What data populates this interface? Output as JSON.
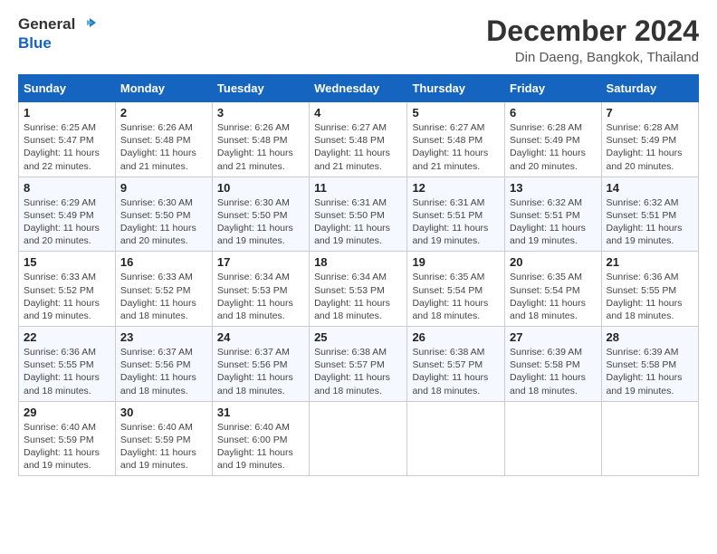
{
  "logo": {
    "line1": "General",
    "line2": "Blue"
  },
  "title": "December 2024",
  "location": "Din Daeng, Bangkok, Thailand",
  "days_of_week": [
    "Sunday",
    "Monday",
    "Tuesday",
    "Wednesday",
    "Thursday",
    "Friday",
    "Saturday"
  ],
  "weeks": [
    [
      {
        "day": "1",
        "sunrise": "6:25 AM",
        "sunset": "5:47 PM",
        "daylight": "11 hours and 22 minutes."
      },
      {
        "day": "2",
        "sunrise": "6:26 AM",
        "sunset": "5:48 PM",
        "daylight": "11 hours and 21 minutes."
      },
      {
        "day": "3",
        "sunrise": "6:26 AM",
        "sunset": "5:48 PM",
        "daylight": "11 hours and 21 minutes."
      },
      {
        "day": "4",
        "sunrise": "6:27 AM",
        "sunset": "5:48 PM",
        "daylight": "11 hours and 21 minutes."
      },
      {
        "day": "5",
        "sunrise": "6:27 AM",
        "sunset": "5:48 PM",
        "daylight": "11 hours and 21 minutes."
      },
      {
        "day": "6",
        "sunrise": "6:28 AM",
        "sunset": "5:49 PM",
        "daylight": "11 hours and 20 minutes."
      },
      {
        "day": "7",
        "sunrise": "6:28 AM",
        "sunset": "5:49 PM",
        "daylight": "11 hours and 20 minutes."
      }
    ],
    [
      {
        "day": "8",
        "sunrise": "6:29 AM",
        "sunset": "5:49 PM",
        "daylight": "11 hours and 20 minutes."
      },
      {
        "day": "9",
        "sunrise": "6:30 AM",
        "sunset": "5:50 PM",
        "daylight": "11 hours and 20 minutes."
      },
      {
        "day": "10",
        "sunrise": "6:30 AM",
        "sunset": "5:50 PM",
        "daylight": "11 hours and 19 minutes."
      },
      {
        "day": "11",
        "sunrise": "6:31 AM",
        "sunset": "5:50 PM",
        "daylight": "11 hours and 19 minutes."
      },
      {
        "day": "12",
        "sunrise": "6:31 AM",
        "sunset": "5:51 PM",
        "daylight": "11 hours and 19 minutes."
      },
      {
        "day": "13",
        "sunrise": "6:32 AM",
        "sunset": "5:51 PM",
        "daylight": "11 hours and 19 minutes."
      },
      {
        "day": "14",
        "sunrise": "6:32 AM",
        "sunset": "5:51 PM",
        "daylight": "11 hours and 19 minutes."
      }
    ],
    [
      {
        "day": "15",
        "sunrise": "6:33 AM",
        "sunset": "5:52 PM",
        "daylight": "11 hours and 19 minutes."
      },
      {
        "day": "16",
        "sunrise": "6:33 AM",
        "sunset": "5:52 PM",
        "daylight": "11 hours and 18 minutes."
      },
      {
        "day": "17",
        "sunrise": "6:34 AM",
        "sunset": "5:53 PM",
        "daylight": "11 hours and 18 minutes."
      },
      {
        "day": "18",
        "sunrise": "6:34 AM",
        "sunset": "5:53 PM",
        "daylight": "11 hours and 18 minutes."
      },
      {
        "day": "19",
        "sunrise": "6:35 AM",
        "sunset": "5:54 PM",
        "daylight": "11 hours and 18 minutes."
      },
      {
        "day": "20",
        "sunrise": "6:35 AM",
        "sunset": "5:54 PM",
        "daylight": "11 hours and 18 minutes."
      },
      {
        "day": "21",
        "sunrise": "6:36 AM",
        "sunset": "5:55 PM",
        "daylight": "11 hours and 18 minutes."
      }
    ],
    [
      {
        "day": "22",
        "sunrise": "6:36 AM",
        "sunset": "5:55 PM",
        "daylight": "11 hours and 18 minutes."
      },
      {
        "day": "23",
        "sunrise": "6:37 AM",
        "sunset": "5:56 PM",
        "daylight": "11 hours and 18 minutes."
      },
      {
        "day": "24",
        "sunrise": "6:37 AM",
        "sunset": "5:56 PM",
        "daylight": "11 hours and 18 minutes."
      },
      {
        "day": "25",
        "sunrise": "6:38 AM",
        "sunset": "5:57 PM",
        "daylight": "11 hours and 18 minutes."
      },
      {
        "day": "26",
        "sunrise": "6:38 AM",
        "sunset": "5:57 PM",
        "daylight": "11 hours and 18 minutes."
      },
      {
        "day": "27",
        "sunrise": "6:39 AM",
        "sunset": "5:58 PM",
        "daylight": "11 hours and 18 minutes."
      },
      {
        "day": "28",
        "sunrise": "6:39 AM",
        "sunset": "5:58 PM",
        "daylight": "11 hours and 19 minutes."
      }
    ],
    [
      {
        "day": "29",
        "sunrise": "6:40 AM",
        "sunset": "5:59 PM",
        "daylight": "11 hours and 19 minutes."
      },
      {
        "day": "30",
        "sunrise": "6:40 AM",
        "sunset": "5:59 PM",
        "daylight": "11 hours and 19 minutes."
      },
      {
        "day": "31",
        "sunrise": "6:40 AM",
        "sunset": "6:00 PM",
        "daylight": "11 hours and 19 minutes."
      },
      null,
      null,
      null,
      null
    ]
  ]
}
